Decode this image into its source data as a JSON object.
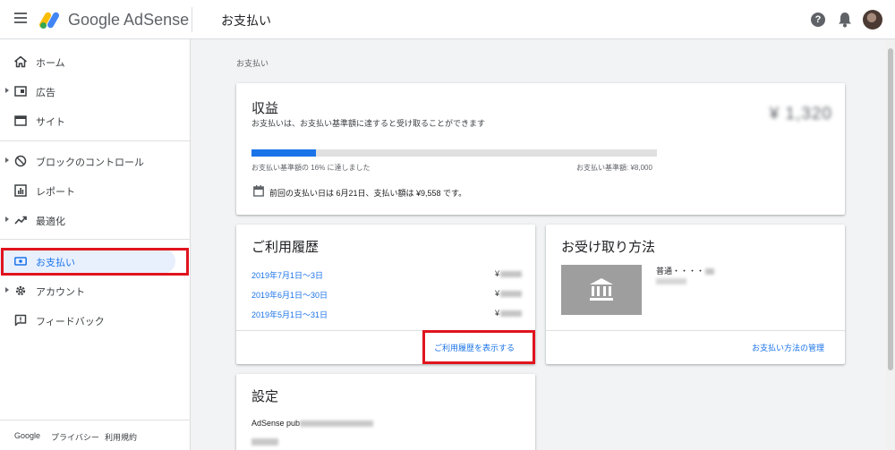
{
  "header": {
    "logo_text": "Google AdSense",
    "page_title": "お支払い",
    "help_glyph": "?"
  },
  "sidebar": {
    "items": [
      {
        "label": "ホーム",
        "icon": "home-icon"
      },
      {
        "label": "広告",
        "icon": "ads-icon"
      },
      {
        "label": "サイト",
        "icon": "sites-icon"
      },
      {
        "label": "ブロックのコントロール",
        "icon": "block-icon"
      },
      {
        "label": "レポート",
        "icon": "report-icon"
      },
      {
        "label": "最適化",
        "icon": "trending-icon"
      },
      {
        "label": "お支払い",
        "icon": "payments-icon"
      },
      {
        "label": "アカウント",
        "icon": "gear-icon"
      },
      {
        "label": "フィードバック",
        "icon": "feedback-icon"
      }
    ],
    "footer": {
      "google": "Google",
      "privacy": "プライバシー",
      "terms": "利用規約"
    }
  },
  "breadcrumb": "お支払い",
  "earnings": {
    "title": "収益",
    "subtitle": "お支払いは、お支払い基準額に達すると受け取ることができます",
    "amount": "¥ 1,320",
    "progress_percent": 16,
    "progress_left": "お支払い基準額の 16% に達しました",
    "progress_right": "お支払い基準額: ¥8,000",
    "last_payment": "前回の支払い日は 6月21日、支払い額は ¥9,558 です。"
  },
  "history": {
    "title": "ご利用履歴",
    "rows": [
      {
        "date": "2019年7月1日～3日",
        "amount": "¥"
      },
      {
        "date": "2019年6月1日～30日",
        "amount": "¥"
      },
      {
        "date": "2019年5月1日～31日",
        "amount": "¥"
      }
    ],
    "link": "ご利用履歴を表示する"
  },
  "receive": {
    "title": "お受け取り方法",
    "bank_text": "普通・・・・",
    "link": "お支払い方法の管理"
  },
  "settings": {
    "title": "設定",
    "pub_label": "AdSense pub"
  },
  "colors": {
    "accent": "#1a73e8",
    "highlight": "#e0141e"
  }
}
